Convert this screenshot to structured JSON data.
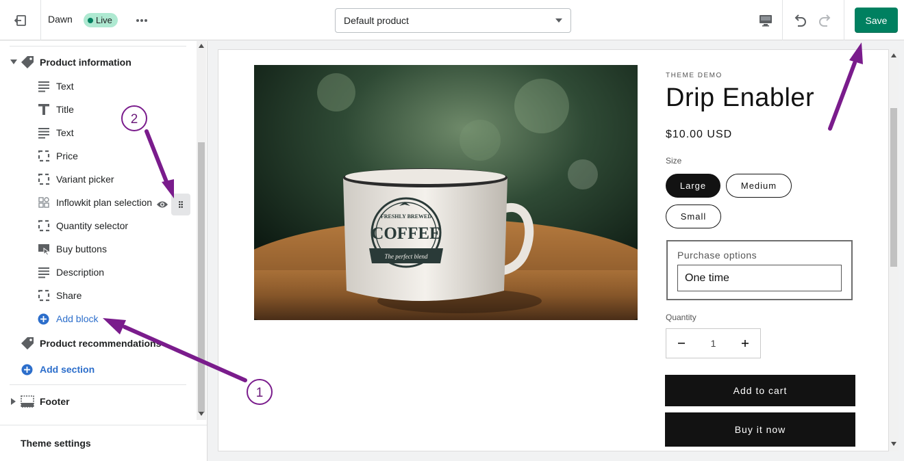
{
  "topbar": {
    "exit_icon": "exit-icon",
    "theme_name": "Dawn",
    "live_badge": "Live",
    "more_icon": "more-horizontal-icon",
    "template_selected": "Default product",
    "device_icon": "desktop-icon",
    "undo_icon": "undo-icon",
    "redo_icon": "redo-icon",
    "save_label": "Save"
  },
  "sidebar": {
    "group_product_info": "Product information",
    "blocks": [
      {
        "label": "Text",
        "icon": "text-lines-icon"
      },
      {
        "label": "Title",
        "icon": "title-t-icon"
      },
      {
        "label": "Text",
        "icon": "text-lines-icon"
      },
      {
        "label": "Price",
        "icon": "dashed-square-icon"
      },
      {
        "label": "Variant picker",
        "icon": "dashed-square-icon"
      },
      {
        "label": "Inflowkit plan selection",
        "icon": "app-block-icon"
      },
      {
        "label": "Quantity selector",
        "icon": "dashed-square-icon"
      },
      {
        "label": "Buy buttons",
        "icon": "buy-buttons-icon"
      },
      {
        "label": "Description",
        "icon": "text-lines-icon"
      },
      {
        "label": "Share",
        "icon": "dashed-square-icon"
      }
    ],
    "add_block": "Add block",
    "group_recommendations": "Product recommendations",
    "add_section": "Add section",
    "footer": "Footer",
    "theme_settings": "Theme settings"
  },
  "preview": {
    "vendor": "THEME DEMO",
    "title": "Drip Enabler",
    "price": "$10.00 USD",
    "size_label": "Size",
    "sizes": [
      "Large",
      "Medium",
      "Small"
    ],
    "selected_size": "Large",
    "purchase_label": "Purchase options",
    "purchase_value": "One time",
    "quantity_label": "Quantity",
    "quantity_value": "1",
    "add_to_cart": "Add to cart",
    "buy_now": "Buy it now",
    "mug": {
      "line1": "FRESHLY BREWED",
      "line2": "COFFEE",
      "line3": "The perfect blend"
    }
  },
  "annotations": {
    "step1": "1",
    "step2": "2"
  },
  "colors": {
    "save_green": "#008060",
    "live_bg": "#aee9d1",
    "link_blue": "#2c6ecb",
    "annotation_purple": "#7a1c8c"
  }
}
